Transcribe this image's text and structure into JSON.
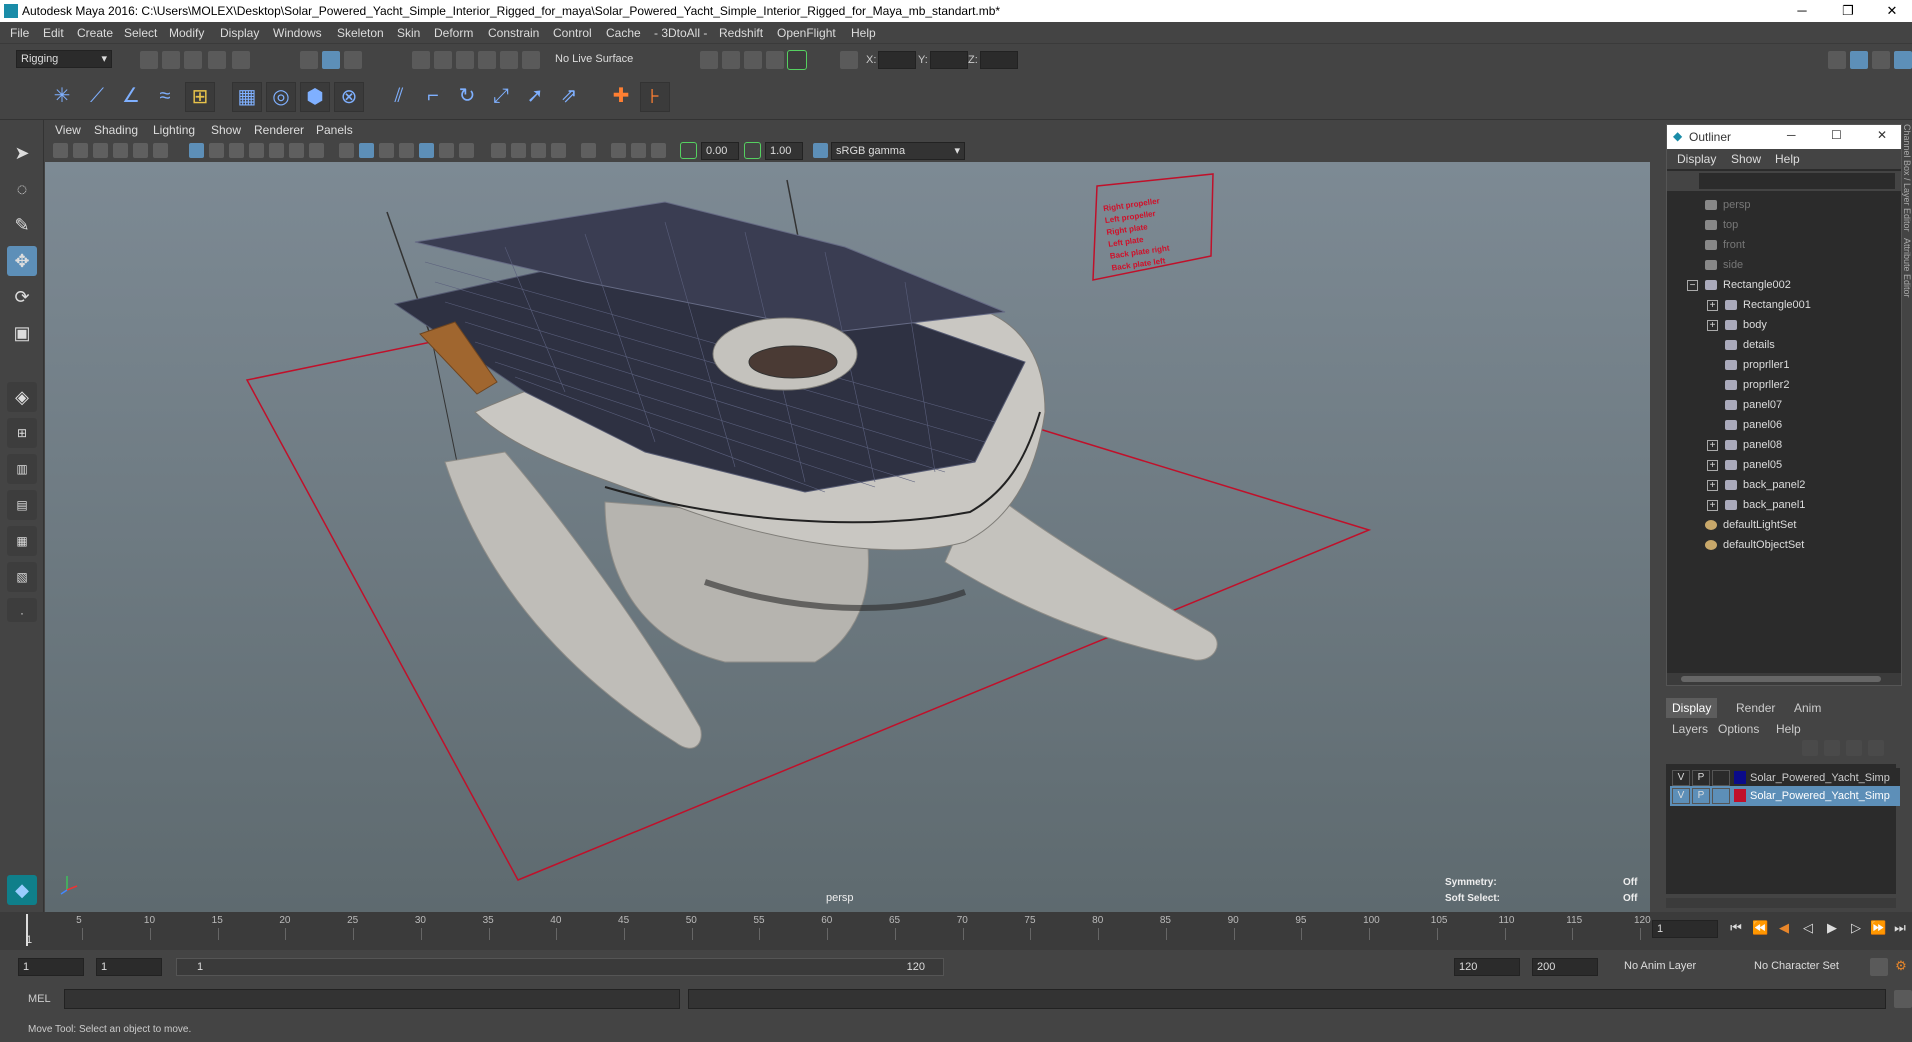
{
  "window": {
    "title": "Autodesk Maya 2016: C:\\Users\\MOLEX\\Desktop\\Solar_Powered_Yacht_Simple_Interior_Rigged_for_maya\\Solar_Powered_Yacht_Simple_Interior_Rigged_for_Maya_mb_standart.mb*",
    "minimize": "─",
    "restore": "❐",
    "close": "✕"
  },
  "menubar": [
    "File",
    "Edit",
    "Create",
    "Select",
    "Modify",
    "Display",
    "Windows",
    "Skeleton",
    "Skin",
    "Deform",
    "Constrain",
    "Control",
    "Cache",
    "- 3DtoAll -",
    "Redshift",
    "OpenFlight",
    "Help"
  ],
  "statusline": {
    "menuset": "Rigging",
    "live_surface": "No Live Surface",
    "x_label": "X:",
    "y_label": "Y:",
    "z_label": "Z:"
  },
  "viewport_menu": [
    "View",
    "Shading",
    "Lighting",
    "Show",
    "Renderer",
    "Panels"
  ],
  "viewport_toolbar": {
    "exposure": "0.00",
    "gamma": "1.00",
    "color_space": "sRGB gamma"
  },
  "viewport": {
    "camera_label": "persp",
    "symmetry_label": "Symmetry:",
    "symmetry_value": "Off",
    "soft_select_label": "Soft Select:",
    "soft_select_value": "Off",
    "board_lines": [
      "Right propeller",
      "Left propeller",
      "Right plate",
      "Left plate",
      "Back plate right",
      "Back plate left"
    ]
  },
  "outliner": {
    "title": "Outliner",
    "menu": [
      "Display",
      "Show",
      "Help"
    ],
    "items": [
      {
        "label": "persp",
        "kind": "camera",
        "indent": 0
      },
      {
        "label": "top",
        "kind": "camera",
        "indent": 0
      },
      {
        "label": "front",
        "kind": "camera",
        "indent": 0
      },
      {
        "label": "side",
        "kind": "camera",
        "indent": 0
      },
      {
        "label": "Rectangle002",
        "kind": "group",
        "indent": 0,
        "expander": "−"
      },
      {
        "label": "Rectangle001",
        "kind": "group",
        "indent": 1,
        "expander": "+"
      },
      {
        "label": "body",
        "kind": "group",
        "indent": 1,
        "expander": "+"
      },
      {
        "label": "details",
        "kind": "group",
        "indent": 1,
        "expander": ""
      },
      {
        "label": "proprller1",
        "kind": "group",
        "indent": 1,
        "expander": ""
      },
      {
        "label": "proprller2",
        "kind": "group",
        "indent": 1,
        "expander": ""
      },
      {
        "label": "panel07",
        "kind": "group",
        "indent": 1,
        "expander": ""
      },
      {
        "label": "panel06",
        "kind": "group",
        "indent": 1,
        "expander": ""
      },
      {
        "label": "panel08",
        "kind": "group",
        "indent": 1,
        "expander": "+"
      },
      {
        "label": "panel05",
        "kind": "group",
        "indent": 1,
        "expander": "+"
      },
      {
        "label": "back_panel2",
        "kind": "group",
        "indent": 1,
        "expander": "+"
      },
      {
        "label": "back_panel1",
        "kind": "group",
        "indent": 1,
        "expander": "+"
      },
      {
        "label": "defaultLightSet",
        "kind": "set",
        "indent": 0
      },
      {
        "label": "defaultObjectSet",
        "kind": "set",
        "indent": 0
      }
    ]
  },
  "layers": {
    "tabs": [
      "Display",
      "Render",
      "Anim"
    ],
    "menu": [
      "Layers",
      "Options",
      "Help"
    ],
    "rows": [
      {
        "v": "V",
        "p": "P",
        "name": "Solar_Powered_Yacht_Simp",
        "color": "#0b0b8a",
        "selected": false
      },
      {
        "v": "V",
        "p": "P",
        "name": "Solar_Powered_Yacht_Simp",
        "color": "#c0102a",
        "selected": true
      }
    ]
  },
  "timeline": {
    "ticks": [
      "5",
      "10",
      "15",
      "20",
      "25",
      "30",
      "35",
      "40",
      "45",
      "50",
      "55",
      "60",
      "65",
      "70",
      "75",
      "80",
      "85",
      "90",
      "95",
      "100",
      "105",
      "110",
      "115",
      "120"
    ],
    "start_marker": "1",
    "current_frame": "1"
  },
  "range": {
    "start": "1",
    "playback_start": "1",
    "slider_start": "1",
    "slider_end": "120",
    "playback_end": "120",
    "end": "200",
    "anim_layer": "No Anim Layer",
    "char_set": "No Character Set"
  },
  "cmd": {
    "label": "MEL"
  },
  "help": {
    "text": "Move Tool: Select an object to move."
  },
  "side_tabs": {
    "channel": "Channel Box / Layer Editor",
    "attr": "Attribute Editor"
  }
}
